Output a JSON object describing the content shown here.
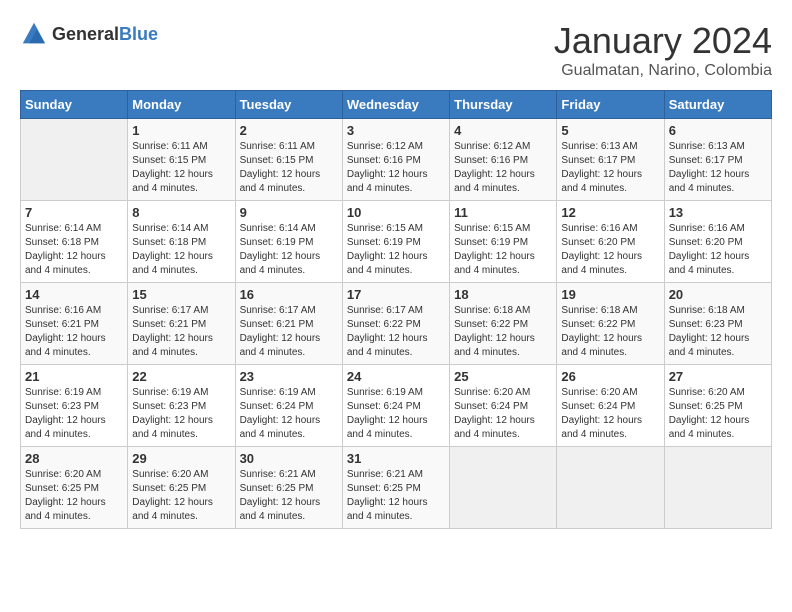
{
  "header": {
    "logo_general": "General",
    "logo_blue": "Blue",
    "month": "January 2024",
    "location": "Gualmatan, Narino, Colombia"
  },
  "days_of_week": [
    "Sunday",
    "Monday",
    "Tuesday",
    "Wednesday",
    "Thursday",
    "Friday",
    "Saturday"
  ],
  "weeks": [
    [
      {
        "day": "",
        "empty": true
      },
      {
        "day": "1",
        "sunrise": "6:11 AM",
        "sunset": "6:15 PM",
        "daylight": "12 hours and 4 minutes."
      },
      {
        "day": "2",
        "sunrise": "6:11 AM",
        "sunset": "6:15 PM",
        "daylight": "12 hours and 4 minutes."
      },
      {
        "day": "3",
        "sunrise": "6:12 AM",
        "sunset": "6:16 PM",
        "daylight": "12 hours and 4 minutes."
      },
      {
        "day": "4",
        "sunrise": "6:12 AM",
        "sunset": "6:16 PM",
        "daylight": "12 hours and 4 minutes."
      },
      {
        "day": "5",
        "sunrise": "6:13 AM",
        "sunset": "6:17 PM",
        "daylight": "12 hours and 4 minutes."
      },
      {
        "day": "6",
        "sunrise": "6:13 AM",
        "sunset": "6:17 PM",
        "daylight": "12 hours and 4 minutes."
      }
    ],
    [
      {
        "day": "7",
        "sunrise": "6:14 AM",
        "sunset": "6:18 PM",
        "daylight": "12 hours and 4 minutes."
      },
      {
        "day": "8",
        "sunrise": "6:14 AM",
        "sunset": "6:18 PM",
        "daylight": "12 hours and 4 minutes."
      },
      {
        "day": "9",
        "sunrise": "6:14 AM",
        "sunset": "6:19 PM",
        "daylight": "12 hours and 4 minutes."
      },
      {
        "day": "10",
        "sunrise": "6:15 AM",
        "sunset": "6:19 PM",
        "daylight": "12 hours and 4 minutes."
      },
      {
        "day": "11",
        "sunrise": "6:15 AM",
        "sunset": "6:19 PM",
        "daylight": "12 hours and 4 minutes."
      },
      {
        "day": "12",
        "sunrise": "6:16 AM",
        "sunset": "6:20 PM",
        "daylight": "12 hours and 4 minutes."
      },
      {
        "day": "13",
        "sunrise": "6:16 AM",
        "sunset": "6:20 PM",
        "daylight": "12 hours and 4 minutes."
      }
    ],
    [
      {
        "day": "14",
        "sunrise": "6:16 AM",
        "sunset": "6:21 PM",
        "daylight": "12 hours and 4 minutes."
      },
      {
        "day": "15",
        "sunrise": "6:17 AM",
        "sunset": "6:21 PM",
        "daylight": "12 hours and 4 minutes."
      },
      {
        "day": "16",
        "sunrise": "6:17 AM",
        "sunset": "6:21 PM",
        "daylight": "12 hours and 4 minutes."
      },
      {
        "day": "17",
        "sunrise": "6:17 AM",
        "sunset": "6:22 PM",
        "daylight": "12 hours and 4 minutes."
      },
      {
        "day": "18",
        "sunrise": "6:18 AM",
        "sunset": "6:22 PM",
        "daylight": "12 hours and 4 minutes."
      },
      {
        "day": "19",
        "sunrise": "6:18 AM",
        "sunset": "6:22 PM",
        "daylight": "12 hours and 4 minutes."
      },
      {
        "day": "20",
        "sunrise": "6:18 AM",
        "sunset": "6:23 PM",
        "daylight": "12 hours and 4 minutes."
      }
    ],
    [
      {
        "day": "21",
        "sunrise": "6:19 AM",
        "sunset": "6:23 PM",
        "daylight": "12 hours and 4 minutes."
      },
      {
        "day": "22",
        "sunrise": "6:19 AM",
        "sunset": "6:23 PM",
        "daylight": "12 hours and 4 minutes."
      },
      {
        "day": "23",
        "sunrise": "6:19 AM",
        "sunset": "6:24 PM",
        "daylight": "12 hours and 4 minutes."
      },
      {
        "day": "24",
        "sunrise": "6:19 AM",
        "sunset": "6:24 PM",
        "daylight": "12 hours and 4 minutes."
      },
      {
        "day": "25",
        "sunrise": "6:20 AM",
        "sunset": "6:24 PM",
        "daylight": "12 hours and 4 minutes."
      },
      {
        "day": "26",
        "sunrise": "6:20 AM",
        "sunset": "6:24 PM",
        "daylight": "12 hours and 4 minutes."
      },
      {
        "day": "27",
        "sunrise": "6:20 AM",
        "sunset": "6:25 PM",
        "daylight": "12 hours and 4 minutes."
      }
    ],
    [
      {
        "day": "28",
        "sunrise": "6:20 AM",
        "sunset": "6:25 PM",
        "daylight": "12 hours and 4 minutes."
      },
      {
        "day": "29",
        "sunrise": "6:20 AM",
        "sunset": "6:25 PM",
        "daylight": "12 hours and 4 minutes."
      },
      {
        "day": "30",
        "sunrise": "6:21 AM",
        "sunset": "6:25 PM",
        "daylight": "12 hours and 4 minutes."
      },
      {
        "day": "31",
        "sunrise": "6:21 AM",
        "sunset": "6:25 PM",
        "daylight": "12 hours and 4 minutes."
      },
      {
        "day": "",
        "empty": true
      },
      {
        "day": "",
        "empty": true
      },
      {
        "day": "",
        "empty": true
      }
    ]
  ],
  "labels": {
    "sunrise": "Sunrise:",
    "sunset": "Sunset:",
    "daylight": "Daylight:"
  }
}
